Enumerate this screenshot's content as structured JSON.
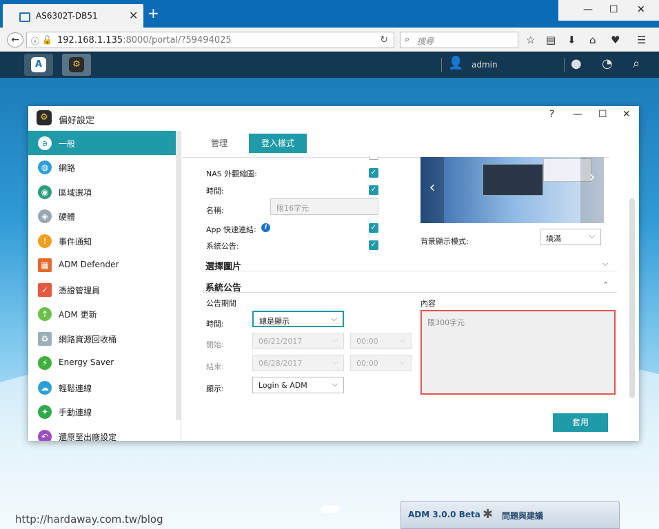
{
  "browser": {
    "tab_title": "AS6302T-DB51",
    "new_tab": "+",
    "url_host": "192.168.1.135",
    "url_rest": ":8000/portal/?59494025",
    "search_placeholder": "搜尋",
    "win_min": "—",
    "win_max": "☐",
    "win_close": "✕"
  },
  "adm_bar": {
    "username": "admin"
  },
  "window": {
    "title": "偏好設定",
    "help": "?",
    "min": "—",
    "max": "☐",
    "close": "✕"
  },
  "sidebar": {
    "items": [
      {
        "label": "一般",
        "icon": "general-icon",
        "color": "#1f9aa8"
      },
      {
        "label": "網路",
        "icon": "globe-icon",
        "color": "#2c9fd6"
      },
      {
        "label": "區域選項",
        "icon": "region-icon",
        "color": "#2a9e7e"
      },
      {
        "label": "硬體",
        "icon": "hardware-icon",
        "color": "#9aa6b2"
      },
      {
        "label": "事件通知",
        "icon": "alert-icon",
        "color": "#f0a020"
      },
      {
        "label": "ADM Defender",
        "icon": "firewall-icon",
        "color": "#e36b2b"
      },
      {
        "label": "憑證管理員",
        "icon": "certificate-icon",
        "color": "#e35a40"
      },
      {
        "label": "ADM 更新",
        "icon": "update-arrow-icon",
        "color": "#6cc04a"
      },
      {
        "label": "網路資源回收桶",
        "icon": "recycle-icon",
        "color": "#9bb0b8"
      },
      {
        "label": "Energy Saver",
        "icon": "energy-icon",
        "color": "#3fae3a"
      },
      {
        "label": "輕鬆連線",
        "icon": "cloud-icon",
        "color": "#2aa0d6"
      },
      {
        "label": "手動連線",
        "icon": "connect-icon",
        "color": "#2eaa4a"
      },
      {
        "label": "還原至出廠設定",
        "icon": "restore-icon",
        "color": "#9a4fc0"
      }
    ]
  },
  "tabs": [
    {
      "label": "管理"
    },
    {
      "label": "登入樣式"
    }
  ],
  "login_style": {
    "nas_thumbnail_label": "NAS 外觀縮圖:",
    "time_label": "時間:",
    "name_label": "名稱:",
    "name_placeholder": "限16字元",
    "app_quick_label": "App 快速連結:",
    "announce_label": "系統公告:",
    "bg_mode_label": "背景顯示模式:",
    "bg_mode_value": "填滿",
    "select_image_section": "選擇圖片",
    "announcement_section": "系統公告",
    "period_label": "公告期間",
    "content_label": "內容",
    "period_time_label": "時間:",
    "period_time_value": "總是顯示",
    "start_label": "開始:",
    "start_date": "06/21/2017",
    "start_time": "00:00",
    "end_label": "結束:",
    "end_date": "06/28/2017",
    "end_time": "00:00",
    "display_label": "顯示:",
    "display_value": "Login & ADM",
    "content_placeholder": "限300字元",
    "apply": "套用"
  },
  "bottom": {
    "adm_version": "ADM 3.0.0 Beta",
    "feedback": "問題與建議",
    "watermark": "http://hardaway.com.tw/blog"
  }
}
